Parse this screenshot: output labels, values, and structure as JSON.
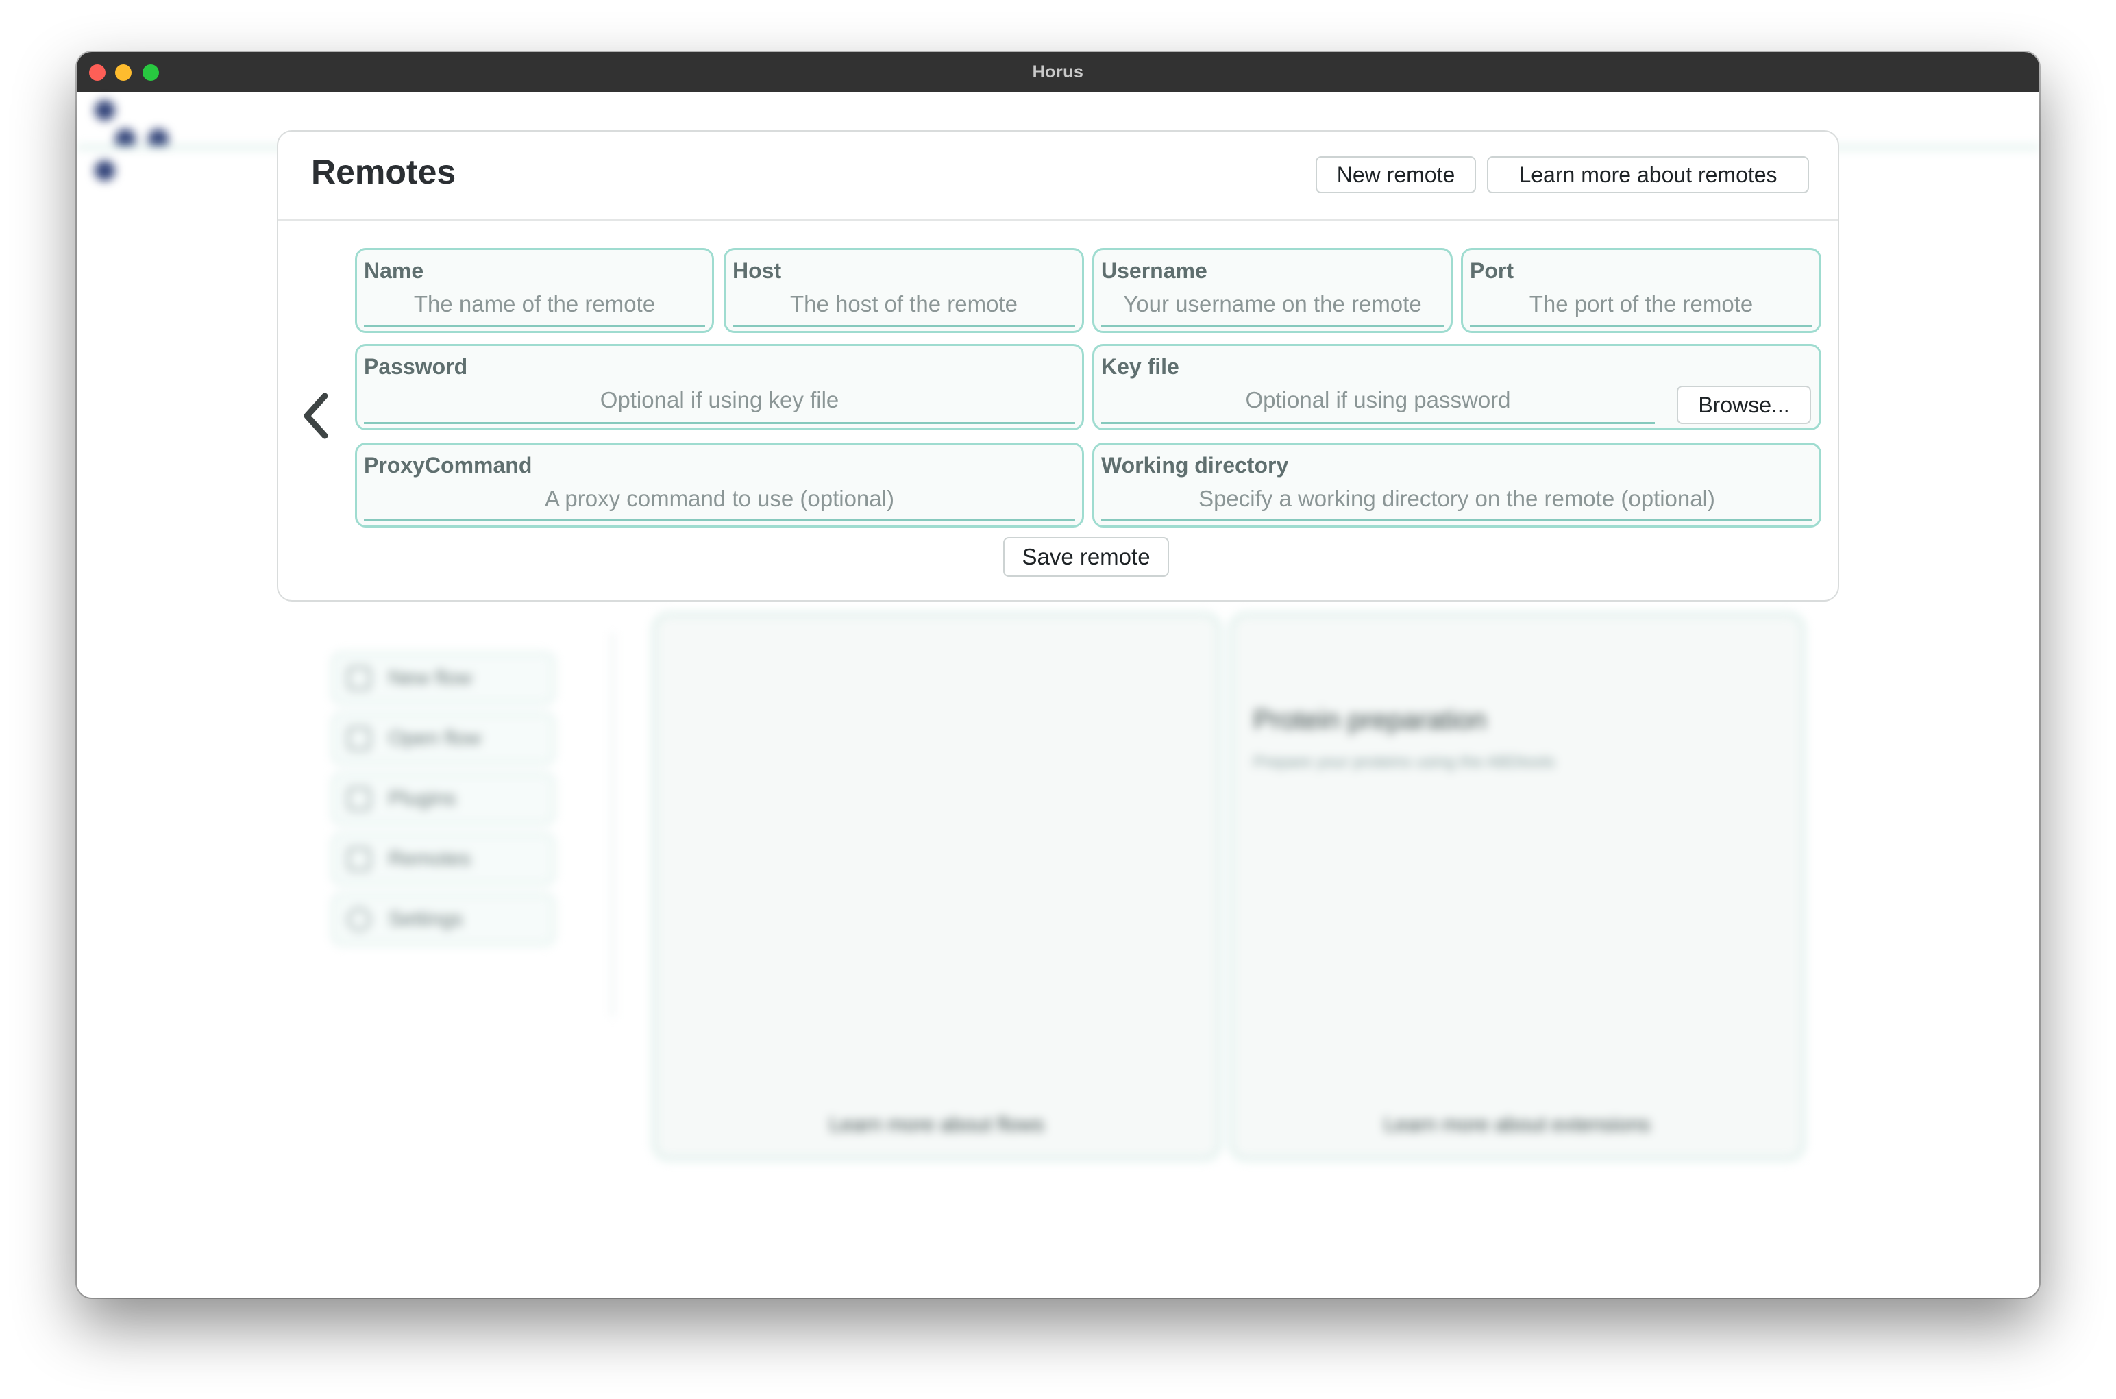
{
  "window": {
    "title": "Horus",
    "controls": [
      "close",
      "minimize",
      "maximize"
    ]
  },
  "background": {
    "menu_items": [
      {
        "label": "New flow",
        "icon": "file-icon"
      },
      {
        "label": "Open flow",
        "icon": "folder-icon"
      },
      {
        "label": "Plugins",
        "icon": "puzzle-icon"
      },
      {
        "label": "Remotes",
        "icon": "server-icon"
      },
      {
        "label": "Settings",
        "icon": "gear-icon"
      }
    ],
    "cards": [
      {
        "title": "",
        "subtitle": "",
        "footer": "Learn more about flows"
      },
      {
        "title": "Protein preparation",
        "subtitle": "Prepare your proteins using the ABDtools",
        "footer": "Learn more about extensions"
      }
    ]
  },
  "modal": {
    "title": "Remotes",
    "new_remote_label": "New remote",
    "learn_more_label": "Learn more about remotes",
    "back_icon": "chevron-left-icon",
    "fields": {
      "name": {
        "label": "Name",
        "placeholder": "The name of the remote"
      },
      "host": {
        "label": "Host",
        "placeholder": "The host of the remote"
      },
      "username": {
        "label": "Username",
        "placeholder": "Your username on the remote"
      },
      "port": {
        "label": "Port",
        "placeholder": "The port of the remote"
      },
      "password": {
        "label": "Password",
        "placeholder": "Optional if using key file"
      },
      "key_file": {
        "label": "Key file",
        "placeholder": "Optional if using password",
        "browse_label": "Browse..."
      },
      "proxy_command": {
        "label": "ProxyCommand",
        "placeholder": "A proxy command to use (optional)"
      },
      "working_directory": {
        "label": "Working directory",
        "placeholder": "Specify a working directory on the remote (optional)"
      }
    },
    "save_label": "Save remote"
  },
  "colors": {
    "accent_border": "#9fdcd0",
    "accent_line": "#86c9bd",
    "titlebar": "#323232"
  }
}
